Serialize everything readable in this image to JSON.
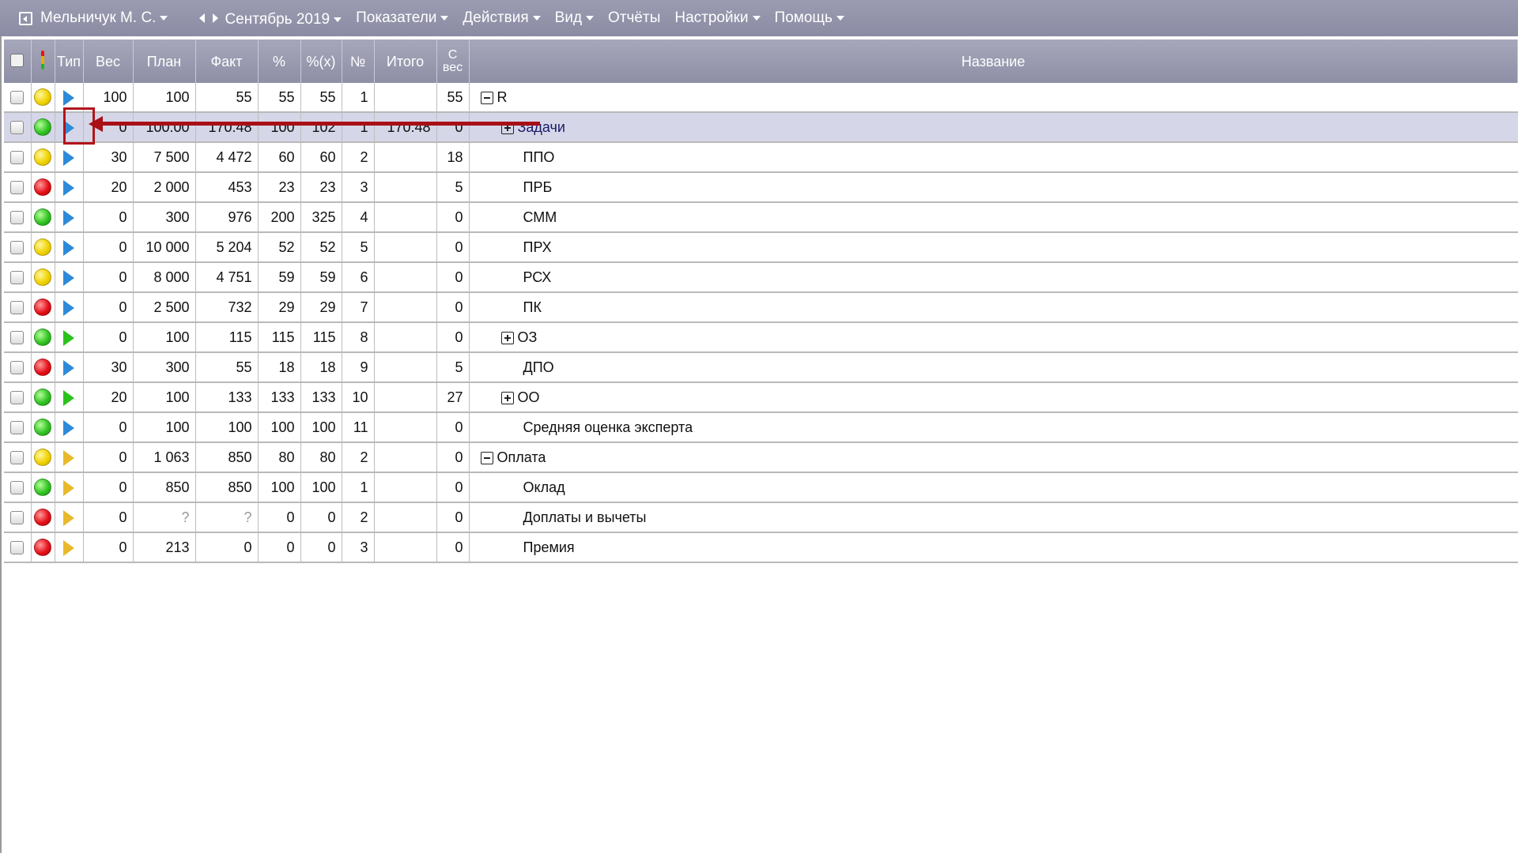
{
  "menu": {
    "user": "Мельничук М. С.",
    "period": "Сентябрь 2019",
    "items": [
      "Показатели",
      "Действия",
      "Вид",
      "Отчёты",
      "Настройки",
      "Помощь"
    ]
  },
  "columns": {
    "type": "Тип",
    "weight": "Вес",
    "plan": "План",
    "fact": "Факт",
    "pct": "%",
    "pct_x": "%(x)",
    "num": "№",
    "total": "Итого",
    "with_weight": "С вес",
    "name": "Название"
  },
  "rows": [
    {
      "status": "yellow",
      "type": "blue",
      "weight": "100",
      "plan": "100",
      "fact": "55",
      "pct": "55",
      "pct_x": "55",
      "num": "1",
      "total": "",
      "with_weight": "55",
      "name": "R",
      "expander": "minus",
      "indent": 0,
      "selected": false
    },
    {
      "status": "green",
      "type": "blue",
      "weight": "0",
      "plan": "100.00",
      "fact": "170.48",
      "pct": "100",
      "pct_x": "102",
      "num": "1",
      "total": "170.48",
      "with_weight": "0",
      "name": "Задачи",
      "expander": "plus",
      "indent": 1,
      "selected": true
    },
    {
      "status": "yellow",
      "type": "blue",
      "weight": "30",
      "plan": "7 500",
      "fact": "4 472",
      "pct": "60",
      "pct_x": "60",
      "num": "2",
      "total": "",
      "with_weight": "18",
      "name": "ППО",
      "expander": "",
      "indent": 1,
      "selected": false
    },
    {
      "status": "red",
      "type": "blue",
      "weight": "20",
      "plan": "2 000",
      "fact": "453",
      "pct": "23",
      "pct_x": "23",
      "num": "3",
      "total": "",
      "with_weight": "5",
      "name": "ПРБ",
      "expander": "",
      "indent": 1,
      "selected": false
    },
    {
      "status": "green",
      "type": "blue",
      "weight": "0",
      "plan": "300",
      "fact": "976",
      "pct": "200",
      "pct_x": "325",
      "num": "4",
      "total": "",
      "with_weight": "0",
      "name": "СММ",
      "expander": "",
      "indent": 1,
      "selected": false
    },
    {
      "status": "yellow",
      "type": "blue",
      "weight": "0",
      "plan": "10 000",
      "fact": "5 204",
      "pct": "52",
      "pct_x": "52",
      "num": "5",
      "total": "",
      "with_weight": "0",
      "name": "ПРХ",
      "expander": "",
      "indent": 1,
      "selected": false
    },
    {
      "status": "yellow",
      "type": "blue",
      "weight": "0",
      "plan": "8 000",
      "fact": "4 751",
      "pct": "59",
      "pct_x": "59",
      "num": "6",
      "total": "",
      "with_weight": "0",
      "name": "РСХ",
      "expander": "",
      "indent": 1,
      "selected": false
    },
    {
      "status": "red",
      "type": "blue",
      "weight": "0",
      "plan": "2 500",
      "fact": "732",
      "pct": "29",
      "pct_x": "29",
      "num": "7",
      "total": "",
      "with_weight": "0",
      "name": "ПК",
      "expander": "",
      "indent": 1,
      "selected": false
    },
    {
      "status": "green",
      "type": "green",
      "weight": "0",
      "plan": "100",
      "fact": "115",
      "pct": "115",
      "pct_x": "115",
      "num": "8",
      "total": "",
      "with_weight": "0",
      "name": "ОЗ",
      "expander": "plus",
      "indent": 1,
      "selected": false
    },
    {
      "status": "red",
      "type": "blue",
      "weight": "30",
      "plan": "300",
      "fact": "55",
      "pct": "18",
      "pct_x": "18",
      "num": "9",
      "total": "",
      "with_weight": "5",
      "name": "ДПО",
      "expander": "",
      "indent": 1,
      "selected": false
    },
    {
      "status": "green",
      "type": "green",
      "weight": "20",
      "plan": "100",
      "fact": "133",
      "pct": "133",
      "pct_x": "133",
      "num": "10",
      "total": "",
      "with_weight": "27",
      "name": "ОО",
      "expander": "plus",
      "indent": 1,
      "selected": false
    },
    {
      "status": "green",
      "type": "blue",
      "weight": "0",
      "plan": "100",
      "fact": "100",
      "pct": "100",
      "pct_x": "100",
      "num": "11",
      "total": "",
      "with_weight": "0",
      "name": "Средняя оценка эксперта",
      "expander": "",
      "indent": 1,
      "selected": false
    },
    {
      "status": "yellow",
      "type": "gold",
      "weight": "0",
      "plan": "1 063",
      "fact": "850",
      "pct": "80",
      "pct_x": "80",
      "num": "2",
      "total": "",
      "with_weight": "0",
      "name": "Оплата",
      "expander": "minus",
      "indent": 0,
      "selected": false
    },
    {
      "status": "green",
      "type": "gold",
      "weight": "0",
      "plan": "850",
      "fact": "850",
      "pct": "100",
      "pct_x": "100",
      "num": "1",
      "total": "",
      "with_weight": "0",
      "name": "Оклад",
      "expander": "",
      "indent": 1,
      "selected": false
    },
    {
      "status": "red",
      "type": "gold",
      "weight": "0",
      "plan": "?",
      "fact": "?",
      "pct": "0",
      "pct_x": "0",
      "num": "2",
      "total": "",
      "with_weight": "0",
      "name": "Доплаты и вычеты",
      "expander": "",
      "indent": 1,
      "selected": false
    },
    {
      "status": "red",
      "type": "gold",
      "weight": "0",
      "plan": "213",
      "fact": "0",
      "pct": "0",
      "pct_x": "0",
      "num": "3",
      "total": "",
      "with_weight": "0",
      "name": "Премия",
      "expander": "",
      "indent": 1,
      "selected": false
    }
  ],
  "colors": {
    "menubar": "#9b9cb1",
    "selected_row": "#d6d6e9",
    "annotation": "#b3141b",
    "status_yellow": "#f1d200",
    "status_green": "#33c424",
    "status_red": "#e6111a",
    "type_blue": "#2d8ad8",
    "type_green": "#2bc21c",
    "type_gold": "#e9b92c"
  }
}
